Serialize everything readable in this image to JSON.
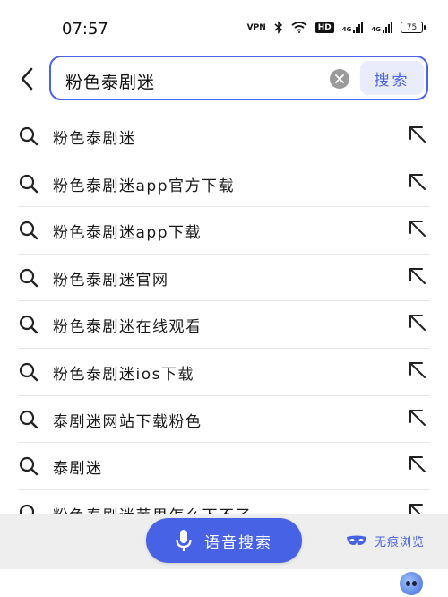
{
  "status_bar": {
    "time": "07:57",
    "vpn_label": "VPN",
    "hd_label": "HD",
    "net1_label": "4G",
    "net2_label": "4G",
    "battery_level": "75",
    "icons": [
      "vpn-icon",
      "bluetooth-icon",
      "wifi-icon",
      "hd-icon",
      "signal-icon",
      "signal-icon",
      "battery-icon"
    ]
  },
  "search": {
    "query": "粉色泰剧迷",
    "button_label": "搜索",
    "accent_color": "#4b63e8"
  },
  "suggestions": [
    "粉色泰剧迷",
    "粉色泰剧迷app官方下载",
    "粉色泰剧迷app下载",
    "粉色泰剧迷官网",
    "粉色泰剧迷在线观看",
    "粉色泰剧迷ios下载",
    "泰剧迷网站下载粉色",
    "泰剧迷",
    "粉色泰剧迷苹果怎么下不了"
  ],
  "bottom": {
    "voice_label": "语音搜索",
    "incognito_label": "无痕浏览",
    "bar_color": "#eeeeee",
    "voice_color": "#4862e6"
  }
}
